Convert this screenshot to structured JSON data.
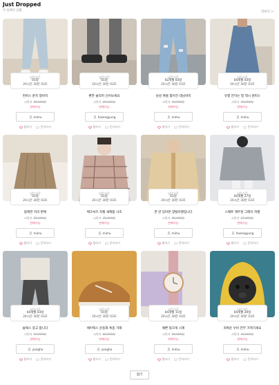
{
  "header": {
    "title": "Just Dropped",
    "subtitle": "막 등록된 상품",
    "more": "더보기 >"
  },
  "products": [
    {
      "auction_label": "남은시간",
      "time_line1": "01일",
      "time_line2": "20시간 30분 03초",
      "title": "컨버스 준지 청바지",
      "price": "시작가",
      "original_price": "50,000원",
      "status": "판매가능",
      "user": "mimu",
      "likes": "찜하기",
      "comments": "문의하기",
      "icon_colors": [
        "#b7c9d6",
        "#e8e2d8"
      ]
    },
    {
      "auction_label": "남은시간",
      "time_line1": "01일",
      "time_line2": "20시간 30분 03초",
      "title": "편한 슬리퍼 신어보세요",
      "price": "시작가",
      "original_price": "20,000원",
      "status": "판매가능",
      "user": "hasengyung",
      "likes": "찜하기",
      "comments": "문의하기",
      "icon_colors": [
        "#2a2a2a",
        "#cfc6bb"
      ]
    },
    {
      "auction_label": "남은시간",
      "time_line1": "02개월 03일",
      "time_line2": "20시간 30분 03초",
      "title": "남성 여름 찢어진 데님바지",
      "price": "시작가",
      "original_price": "30,000원",
      "status": "판매가능",
      "user": "mimu",
      "likes": "찜하기",
      "comments": "문의하기",
      "icon_colors": [
        "#8fb0cf",
        "#c7c0b6"
      ]
    },
    {
      "auction_label": "남은시간",
      "time_line1": "04개월 03일",
      "time_line2": "20시간 30분 03초",
      "title": "유행 만하는 청 맥시 원피스",
      "price": "시작가",
      "original_price": "40,000원",
      "status": "판매가능",
      "user": "mimu",
      "likes": "찜하기",
      "comments": "문의하기",
      "icon_colors": [
        "#5e7fa3",
        "#e6e1d8"
      ]
    },
    {
      "auction_label": "남은시간",
      "time_line1": "01일",
      "time_line2": "20시간 30분 03초",
      "title": "블랙연 지리 판매",
      "price": "시작가",
      "original_price": "25,000원",
      "status": "판매가능",
      "user": "mimu",
      "likes": "찜하기",
      "comments": "문의하기",
      "icon_colors": [
        "#a68b6a",
        "#f1ede6"
      ]
    },
    {
      "auction_label": "남은시간",
      "time_line1": "01일",
      "time_line2": "20시간 30분 03초",
      "title": "체크셔츠 자켓 새제품 사조",
      "price": "시작가",
      "original_price": "35,000원",
      "status": "판매가능",
      "user": "mimu",
      "likes": "찜하기",
      "comments": "문의하기",
      "icon_colors": [
        "#c9a79a",
        "#e8e6e2"
      ]
    },
    {
      "auction_label": "남은시간",
      "time_line1": "01일",
      "time_line2": "20시간 30분 03초",
      "title": "한 번 입어본 양털자켓입니다",
      "price": "시작가",
      "original_price": "45,000원",
      "status": "판매가능",
      "user": "mimu",
      "likes": "찜하기",
      "comments": "문의하기",
      "icon_colors": [
        "#e2cba0",
        "#cbbfae"
      ]
    },
    {
      "auction_label": "남은시간",
      "time_line1": "04개월 27일",
      "time_line2": "20시간 30분 03초",
      "title": "스웨트 캐주얼 그레이 자켓",
      "price": "시작가",
      "original_price": "27,000원",
      "status": "판매가능",
      "user": "hasengyung",
      "likes": "찜하기",
      "comments": "문의하기",
      "icon_colors": [
        "#9aa0a6",
        "#e4e6ea"
      ]
    },
    {
      "auction_label": "남은시간",
      "time_line1": "04개월 03일",
      "time_line2": "20시간 30분 03초",
      "title": "슬랙스 중고 팝니다",
      "price": "시작가",
      "original_price": "19,000원",
      "status": "판매가능",
      "user": "yongho",
      "likes": "찜하기",
      "comments": "문의하기",
      "icon_colors": [
        "#4a4a4a",
        "#c7ccd0"
      ]
    },
    {
      "auction_label": "남은시간",
      "time_line1": "01일",
      "time_line2": "20시간 30분 03초",
      "title": "에어맥스 운동화 특종 거래",
      "price": "시작가",
      "original_price": "80,000원",
      "status": "판매가능",
      "user": "yongho",
      "likes": "찜하기",
      "comments": "문의하기",
      "icon_colors": [
        "#b5783a",
        "#d9a24a"
      ]
    },
    {
      "auction_label": "남은시간",
      "time_line1": "04개월 11일",
      "time_line2": "20시간 30분 03초",
      "title": "예쁜 핑크색 시계",
      "price": "시작가",
      "original_price": "60,000원",
      "status": "판매가능",
      "user": "mimu",
      "likes": "찜하기",
      "comments": "문의하기",
      "icon_colors": [
        "#d9a8ad",
        "#e7e2dc"
      ]
    },
    {
      "auction_label": "남은시간",
      "time_line1": "04개월 20일",
      "time_line2": "20시간 30분 03초",
      "title": "귀여운 우비 전부 가져가세요",
      "price": "시작가",
      "original_price": "20,000원",
      "status": "판매가능",
      "user": "mimu",
      "likes": "찜하기",
      "comments": "문의하기",
      "icon_colors": [
        "#e8c23a",
        "#3a7d8c"
      ]
    }
  ],
  "footer": {
    "load_more": "접기"
  }
}
